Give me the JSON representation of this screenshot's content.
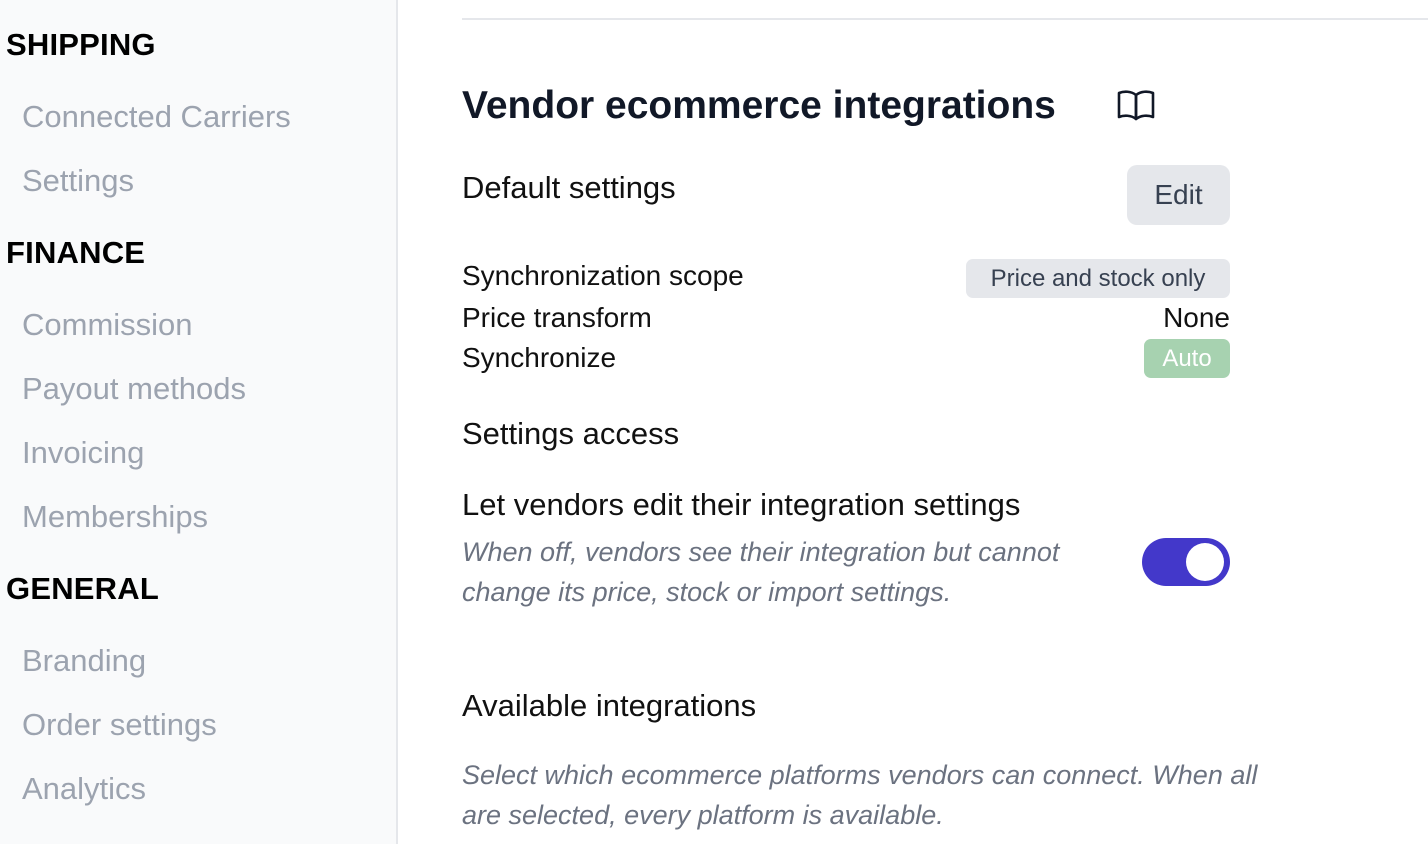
{
  "sidebar": {
    "shipping": {
      "title": "SHIPPING",
      "items": [
        "Connected Carriers",
        "Settings"
      ]
    },
    "finance": {
      "title": "FINANCE",
      "items": [
        "Commission",
        "Payout methods",
        "Invoicing",
        "Memberships"
      ]
    },
    "general": {
      "title": "GENERAL",
      "items": [
        "Branding",
        "Order settings",
        "Analytics"
      ]
    }
  },
  "main": {
    "title": "Vendor ecommerce integrations",
    "default_settings": {
      "heading": "Default settings",
      "edit_label": "Edit",
      "rows": {
        "sync_scope": {
          "label": "Synchronization scope",
          "value": "Price and stock only"
        },
        "price_transform": {
          "label": "Price transform",
          "value": "None"
        },
        "synchronize": {
          "label": "Synchronize",
          "value": "Auto"
        }
      }
    },
    "settings_access": {
      "heading": "Settings access",
      "option_title": "Let vendors edit their integration settings",
      "option_desc": "When off, vendors see their integration but cannot change its price, stock or import settings.",
      "toggle_on": true
    },
    "available_integrations": {
      "heading": "Available integrations",
      "desc": "Select which ecommerce platforms vendors can connect. When all are selected, every platform is available."
    }
  },
  "colors": {
    "accent": "#4338ca",
    "auto_badge": "#a7d2b0",
    "muted_text": "#9ca3af"
  },
  "icons": {
    "docs": "book-open-icon"
  }
}
